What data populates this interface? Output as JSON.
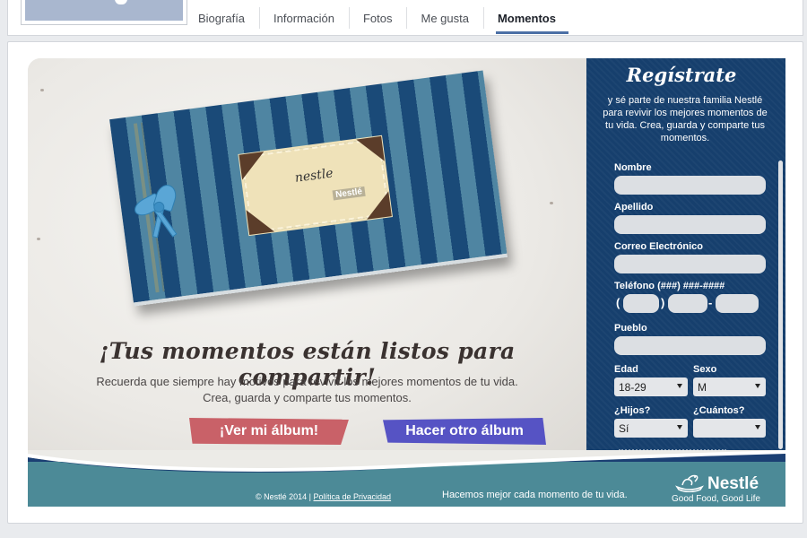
{
  "profile_tabs": [
    {
      "label": "Biografía",
      "active": false
    },
    {
      "label": "Información",
      "active": false
    },
    {
      "label": "Fotos",
      "active": false
    },
    {
      "label": "Me gusta",
      "active": false
    },
    {
      "label": "Momentos",
      "active": true
    }
  ],
  "album": {
    "label_script": "nestle",
    "label_brand": "Nestlé"
  },
  "hero": {
    "headline": "¡Tus momentos están listos para compartir!",
    "copy_line1": "Recuerda que siempre hay motivos para revivir los mejores momentos de tu vida.",
    "copy_line2": "Crea, guarda y comparte tus momentos.",
    "view_album_label": "¡Ver mi álbum!",
    "new_album_label": "Hacer otro álbum",
    "view_album_color": "#c96168",
    "new_album_color": "#5653c4"
  },
  "form": {
    "title": "Regístrate",
    "intro": "y sé parte de nuestra familia Nestlé para revivir los mejores momentos de tu vida. Crea, guarda y comparte tus momentos.",
    "name_label": "Nombre",
    "lastname_label": "Apellido",
    "email_label": "Correo Electrónico",
    "phone_label": "Teléfono (###) ###-####",
    "phone_open": "(",
    "phone_close": ")",
    "phone_dash": "-",
    "town_label": "Pueblo",
    "age_label": "Edad",
    "age_value": "18-29",
    "sex_label": "Sexo",
    "sex_value": "M",
    "kids_label": "¿Hijos?",
    "kids_value": "Sí",
    "howmany_label": "¿Cuántos?",
    "howmany_value": "",
    "panel_color": "#163f6d"
  },
  "footer": {
    "copyright": "© Nestlé 2014 | ",
    "privacy_link": "Política de Privacidad",
    "tagline": "Hacemos mejor cada momento de tu vida.",
    "brand": "Nestlé",
    "brand_slogan": "Good Food, Good Life",
    "band_color": "#4c8a97"
  }
}
